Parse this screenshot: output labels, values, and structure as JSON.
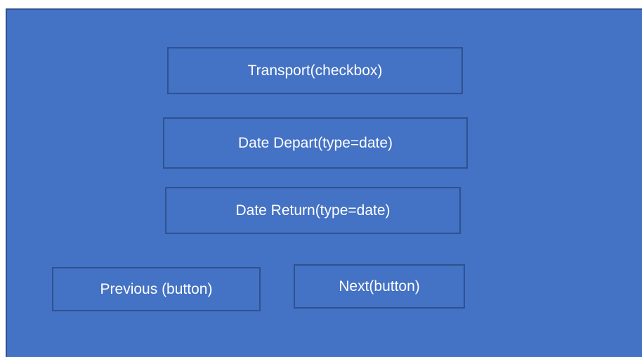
{
  "form": {
    "transport_label": "Transport(checkbox)",
    "date_depart_label": "Date Depart(type=date)",
    "date_return_label": "Date Return(type=date)"
  },
  "nav": {
    "previous_label": "Previous (button)",
    "next_label": "Next(button)"
  },
  "colors": {
    "background": "#4472c4",
    "box_border": "#2f528f",
    "text": "#ffffff"
  }
}
